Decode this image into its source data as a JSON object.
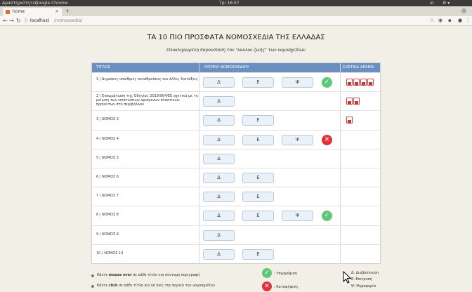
{
  "os_bar": {
    "activities": "Δραστηριότητες",
    "app": "Google Chrome",
    "clock": "Τρι 16:57",
    "lang": "el"
  },
  "browser": {
    "tab_title": "home",
    "tab_close": "×",
    "new_tab": "+",
    "url_host": "localhost",
    "url_path": "/nomosxedia/"
  },
  "page": {
    "title": "ΤΑ 10 ΠΙΟ ΠΡΟΣΦΑΤΑ ΝΟΜΟΣΧΕΔΙΑ ΤΗΣ ΕΛΛΑΔΑΣ",
    "subtitle": "Ολοκληρωμένη παρουσίαση του \"κύκλου ζωής\" των νομοσχεδίων"
  },
  "table": {
    "headers": {
      "title": "ΤΙΤΛΟΣ",
      "progress": "ΠΟΡΕΙΑ ΝΟΜΟΣΧΕΔΙΟΥ",
      "files": "ΣΧΕΤΙΚΑ ΑΡΧΕΙΑ"
    },
    "rows": [
      {
        "title": "1 | Δημόσιες υπαίθριες συναθροίσεις και άλλες διατάξεις",
        "stages": [
          "Δ",
          "Ε",
          "Ψ"
        ],
        "status": "ok",
        "docs": 4
      },
      {
        "title": "2 | Ενσωμάτωση της Οδηγίας 2019/904/ΕΕ σχετικά με τη μείωση των επιπτώσεων ορισμένων πλαστικών προϊόντων στο περιβάλλον",
        "stages": [
          "Δ"
        ],
        "status": "",
        "docs": 2
      },
      {
        "title": "3 | ΝΟΜΟΣ 3",
        "stages": [
          "Δ",
          "Ε"
        ],
        "status": "",
        "docs": 1
      },
      {
        "title": "4 | ΝΟΜΟΣ 4",
        "stages": [
          "Δ",
          "Ε",
          "Ψ"
        ],
        "status": "no",
        "docs": 0
      },
      {
        "title": "5 | ΝΟΜΟΣ 5",
        "stages": [
          "Δ"
        ],
        "status": "",
        "docs": 0
      },
      {
        "title": "6 | ΝΟΜΟΣ 6",
        "stages": [
          "Δ",
          "Ε"
        ],
        "status": "",
        "docs": 0
      },
      {
        "title": "7 | ΝΟΜΟΣ 7",
        "stages": [
          "Δ",
          "Ε"
        ],
        "status": "",
        "docs": 0
      },
      {
        "title": "8 | ΝΟΜΟΣ 8",
        "stages": [
          "Δ",
          "Ε",
          "Ψ"
        ],
        "status": "ok",
        "docs": 0
      },
      {
        "title": "9 | ΝΟΜΟΣ 9",
        "stages": [
          "Δ"
        ],
        "status": "",
        "docs": 0
      },
      {
        "title": "10 | ΝΟΜΟΣ 10",
        "stages": [
          "Δ",
          "Ε"
        ],
        "status": "",
        "docs": 0
      }
    ]
  },
  "legend": {
    "hint1_a": "Κάντε ",
    "hint1_b": "mouse over",
    "hint1_c": " σε κάθε τίτλο για σύντομη περιγραφή",
    "hint2_a": "Κάντε ",
    "hint2_b": "click",
    "hint2_c": " σε κάθε τίτλο για να δείς την πορεία του νομοσχεδίου",
    "approved": ": Υπερψήφιση",
    "rejected": ": Καταψήφιση",
    "abbr_d": "Δ: Διαβούλευση",
    "abbr_e": "Ε: Επιτροπή",
    "abbr_p": "Ψ: Ψηφοφορία"
  },
  "colors": {
    "header_blue": "#6a8fc0",
    "approved_green": "#5ec77a",
    "rejected_red": "#e0333a",
    "page_bg": "#f2efe6"
  }
}
